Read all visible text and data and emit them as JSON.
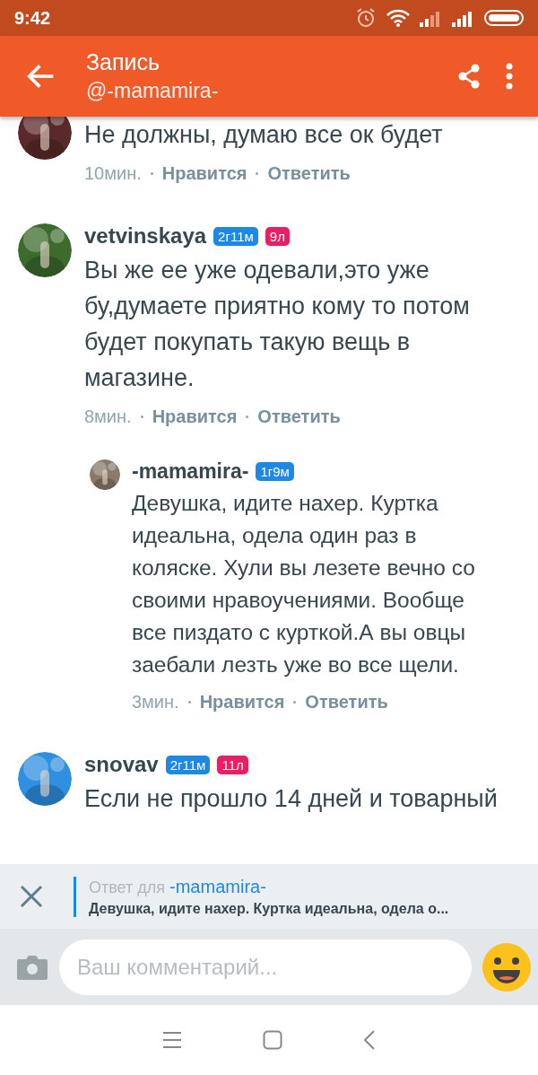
{
  "status_bar": {
    "time": "9:42"
  },
  "app_bar": {
    "title": "Запись",
    "subtitle": "@-mamamira-"
  },
  "comments": [
    {
      "text": "Не должны, думаю все ок будет",
      "time": "10мин.",
      "like": "Нравится",
      "reply": "Ответить"
    },
    {
      "name": "vetvinskaya",
      "badges": [
        {
          "text": "2г11м",
          "color": "#1e88e5"
        },
        {
          "text": "9л",
          "color": "#e91e63"
        }
      ],
      "text": "Вы же ее уже одевали,это уже бу,думаете приятно кому то потом будет покупать такую вещь в магазине.",
      "time": "8мин.",
      "like": "Нравится",
      "reply": "Ответить",
      "children": [
        {
          "name": "-mamamira-",
          "badges": [
            {
              "text": "1г9м",
              "color": "#1e88e5"
            }
          ],
          "text": "Девушка, идите нахер. Куртка идеальна, одела один раз в коляске. Хули вы лезете вечно со своими нравоучениями. Вообще все пиздато с курткой.А вы овцы заебали лезть уже во все щели.",
          "time": "3мин.",
          "like": "Нравится",
          "reply": "Ответить"
        }
      ]
    },
    {
      "name": "snovav",
      "badges": [
        {
          "text": "2г11м",
          "color": "#1e88e5"
        },
        {
          "text": "11л",
          "color": "#e91e63"
        }
      ],
      "text": "Если не прошло 14 дней и товарный"
    }
  ],
  "reply_bar": {
    "label": "Ответ для",
    "target": "-mamamira-",
    "quote": "Девушка, идите нахер. Куртка идеальна, одела о..."
  },
  "composer": {
    "placeholder": "Ваш комментарий..."
  }
}
